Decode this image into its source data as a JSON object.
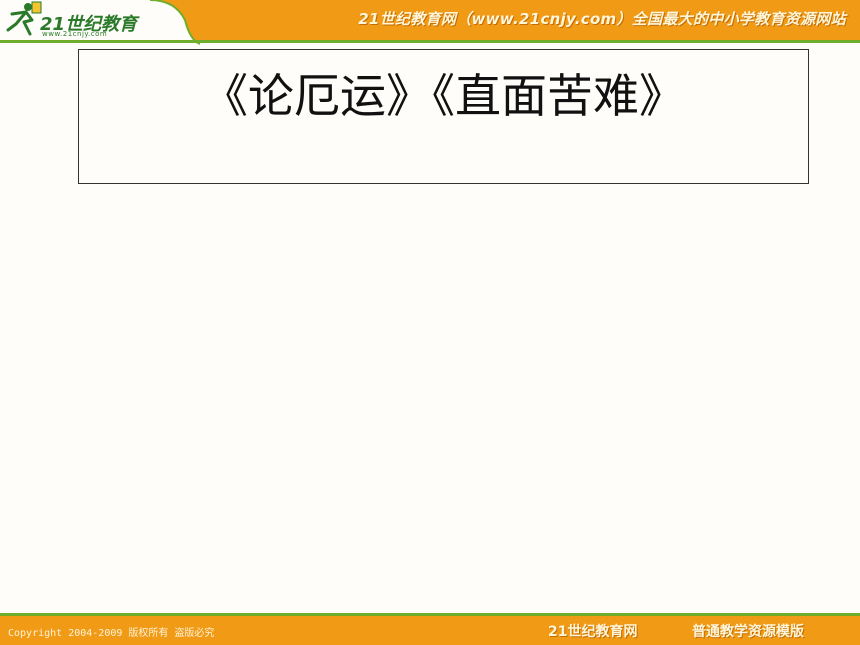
{
  "header": {
    "logo_text": "21世纪教育",
    "logo_sub": "www.21cnjy.com",
    "slogan": "21世纪教育网（www.21cnjy.com）全国最大的中小学教育资源网站"
  },
  "slide": {
    "title": "《论厄运》《直面苦难》"
  },
  "footer": {
    "copyright": "Copyright 2004-2009 版权所有 盗版必究",
    "brand": "21世纪教育网",
    "template": "普通教学资源模版"
  },
  "colors": {
    "banner": "#f19a16",
    "accent_green": "#6fae2a"
  }
}
